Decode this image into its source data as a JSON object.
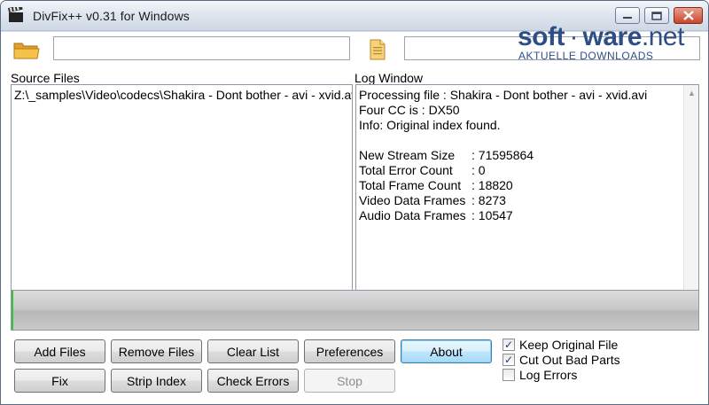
{
  "window": {
    "title": "DivFix++ v0.31 for Windows",
    "icon": "clapperboard-icon"
  },
  "toolbar": {
    "source_path_value": "",
    "destination_path_value": "",
    "open_folder_icon": "folder-open-icon",
    "output_file_icon": "document-icon"
  },
  "watermark": {
    "brand_part1": "soft",
    "brand_sep": " · ",
    "brand_part2": "ware",
    "brand_tld": ".net",
    "subtitle": "AKTUELLE DOWNLOADS"
  },
  "source": {
    "label": "Source Files",
    "items": [
      "Z:\\_samples\\Video\\codecs\\Shakira - Dont bother - avi - xvid.avi"
    ]
  },
  "log": {
    "label": "Log Window",
    "lines": [
      "Processing file : Shakira - Dont bother - avi - xvid.avi",
      "Four CC is : DX50",
      "Info: Original index found."
    ],
    "stats": [
      {
        "key": "New Stream Size",
        "value": ": 71595864"
      },
      {
        "key": "Total Error Count",
        "value": ": 0"
      },
      {
        "key": "Total Frame Count",
        "value": ": 18820"
      },
      {
        "key": "Video Data Frames",
        "value": ": 8273"
      },
      {
        "key": "Audio Data Frames",
        "value": ": 10547"
      }
    ]
  },
  "progress": {
    "fraction": 0.003,
    "fill_color": "#37c437"
  },
  "buttons": {
    "add_files": "Add Files",
    "remove_files": "Remove Files",
    "clear_list": "Clear List",
    "preferences": "Preferences",
    "about": "About",
    "fix": "Fix",
    "strip_index": "Strip Index",
    "check_errors": "Check Errors",
    "stop": "Stop"
  },
  "options": {
    "keep_original_file": {
      "label": "Keep Original File",
      "checked": true
    },
    "cut_out_bad_parts": {
      "label": "Cut Out Bad Parts",
      "checked": true
    },
    "log_errors": {
      "label": "Log Errors",
      "checked": false
    }
  },
  "colors": {
    "title_text": "#1b1b1b",
    "close_button": "#c9442b",
    "watermark_blue": "#2e4f86",
    "focus_blue": "#3c7fb1"
  }
}
